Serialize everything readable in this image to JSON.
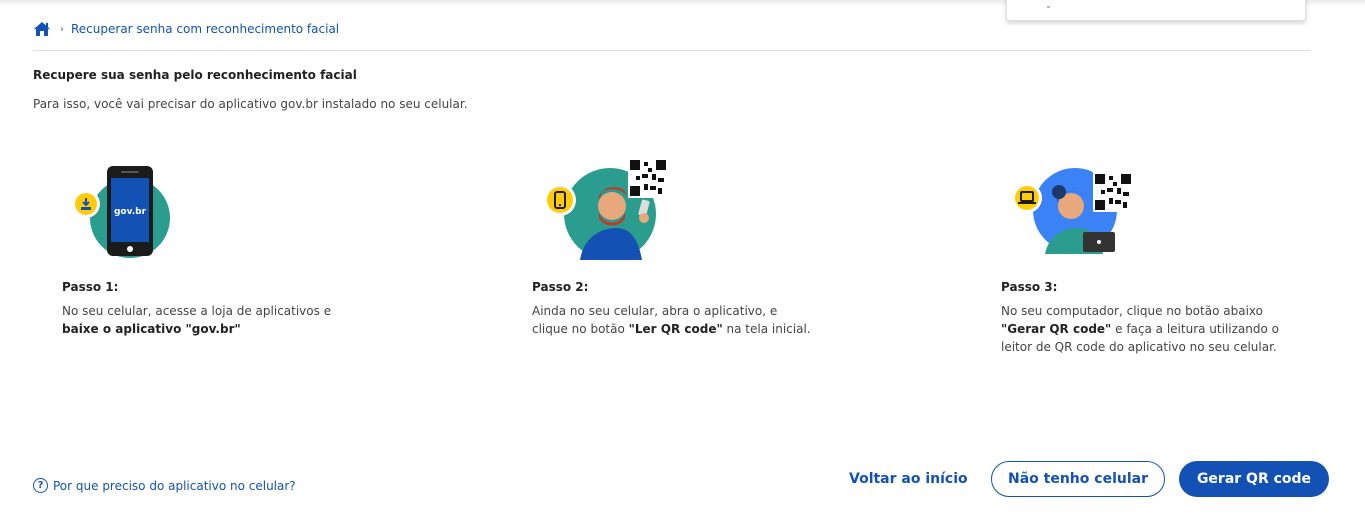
{
  "breadcrumb": {
    "home_icon": "home-icon",
    "separator": "›",
    "current": "Recuperar senha com reconhecimento facial"
  },
  "page": {
    "title": "Recupere sua senha pelo reconhecimento facial",
    "subtitle": "Para isso, você vai precisar do aplicativo gov.br instalado no seu celular."
  },
  "steps": [
    {
      "label": "Passo 1:",
      "text_1": "No seu celular, acesse a loja de aplicativos e",
      "bold_1": "baixe o aplicativo \"gov.br\"",
      "illustration_text": "gov.br",
      "badge_icon": "download-icon"
    },
    {
      "label": "Passo 2:",
      "text_1": "Ainda no seu celular, abra o aplicativo, e clique no botão ",
      "bold_1": "\"Ler QR code\"",
      "text_2": " na tela inicial.",
      "badge_icon": "smartphone-icon"
    },
    {
      "label": "Passo 3:",
      "text_1": "No seu computador, clique no botão abaixo ",
      "bold_1": "\"Gerar QR code\"",
      "text_2": " e faça a leitura utilizando o leitor de QR code do aplicativo no seu celular.",
      "badge_icon": "laptop-icon"
    }
  ],
  "footer": {
    "help_icon": "question-circle-icon",
    "help_text": "Por que preciso do aplicativo no celular?",
    "back_label": "Voltar ao início",
    "no_phone_label": "Não tenho celular",
    "generate_label": "Gerar QR code"
  },
  "colors": {
    "primary": "#1351b4",
    "teal": "#2a9d8f",
    "yellow": "#ffcd07",
    "blue_circle": "#3b82f6"
  }
}
